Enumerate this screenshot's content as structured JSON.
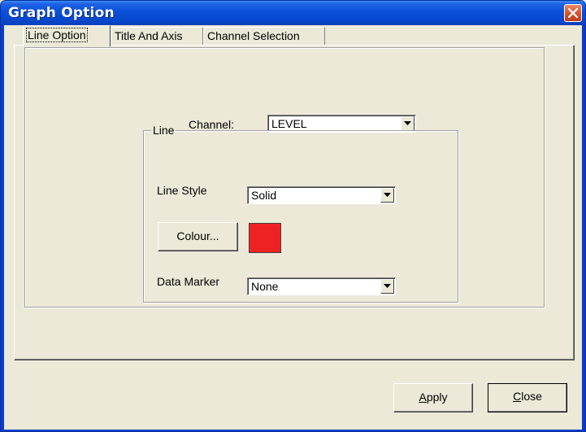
{
  "window": {
    "title": "Graph Option",
    "close_icon": "close-x-icon"
  },
  "tabs": [
    {
      "label": "Line Option",
      "active": true
    },
    {
      "label": "Title And Axis",
      "active": false
    },
    {
      "label": "Channel Selection",
      "active": false
    }
  ],
  "channel": {
    "label": "Channel:",
    "value": "LEVEL"
  },
  "line_group": {
    "title": "Line",
    "line_style": {
      "label": "Line Style",
      "value": "Solid"
    },
    "colour_button": "Colour...",
    "colour_value": "#ee2222",
    "data_marker": {
      "label": "Data Marker",
      "value": "None"
    }
  },
  "buttons": {
    "apply": {
      "accel": "A",
      "rest": "pply"
    },
    "close": {
      "accel": "C",
      "rest": "lose"
    }
  },
  "colors": {
    "titlebar": "#0a4fd8",
    "face": "#ece9d8",
    "close_button": "#d4512a"
  }
}
